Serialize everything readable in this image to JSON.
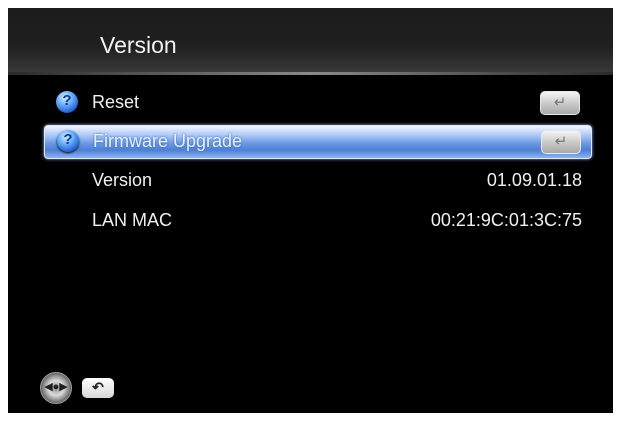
{
  "header": {
    "title": "Version"
  },
  "menu": [
    {
      "label": "Reset",
      "value": "",
      "icon": "help-icon",
      "action_icon": "enter-icon",
      "selected": false
    },
    {
      "label": "Firmware Upgrade",
      "value": "",
      "icon": "help-icon",
      "action_icon": "enter-icon",
      "selected": true
    },
    {
      "label": "Version",
      "value": "01.09.01.18"
    },
    {
      "label": "LAN MAC",
      "value": "00:21:9C:01:3C:75"
    }
  ],
  "footer": {
    "nav_icon": "dpad-icon",
    "back_icon": "return-icon"
  },
  "colors": {
    "background": "#000000",
    "highlight": "#6a98e2",
    "text": "#f0f0f0"
  }
}
